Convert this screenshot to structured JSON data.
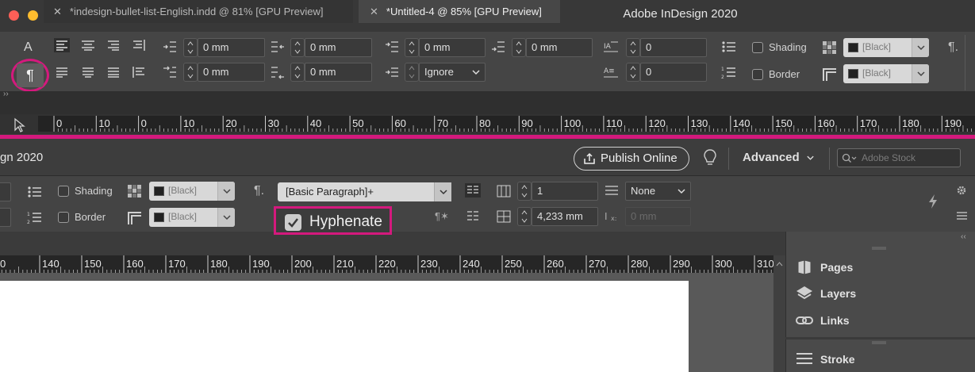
{
  "app": {
    "title": "Adobe InDesign 2020",
    "title_partial": "gn 2020"
  },
  "control_top": {
    "indent_left": "0 mm",
    "indent_first": "0 mm",
    "indent_right": "0 mm",
    "indent_last": "0 mm",
    "space_before": "0 mm",
    "space_after": "0 mm",
    "drop_cap_lines": "0",
    "drop_cap_chars": "0",
    "align_grid": "Ignore",
    "shading_label": "Shading",
    "border_label": "Border",
    "swatch_shading": "[Black]",
    "swatch_border": "[Black]"
  },
  "tabs": [
    {
      "label": "*indesign-bullet-list-English.indd @ 81% [GPU Preview]",
      "active": false
    },
    {
      "label": "*Untitled-4 @ 85% [GPU Preview]",
      "active": true
    }
  ],
  "ruler_top": [
    "0",
    "10",
    "0",
    "10",
    "20",
    "30",
    "40",
    "50",
    "60",
    "70",
    "80",
    "90",
    "100",
    "110",
    "120",
    "130",
    "140",
    "150",
    "160",
    "170",
    "180",
    "190"
  ],
  "header2": {
    "publish_label": "Publish Online",
    "workspace_label": "Advanced",
    "search_placeholder": "Adobe Stock"
  },
  "control_bottom": {
    "shading_label": "Shading",
    "border_label": "Border",
    "swatch_shading": "[Black]",
    "swatch_border": "[Black]",
    "paragraph_style": "[Basic Paragraph]+",
    "hyphenate_label": "Hyphenate",
    "columns": "1",
    "gutter": "4,233 mm",
    "span": "None",
    "span_gutter": "0 mm"
  },
  "ruler_bottom": [
    "0",
    "140",
    "150",
    "160",
    "170",
    "180",
    "190",
    "200",
    "210",
    "220",
    "230",
    "240",
    "250",
    "260",
    "270",
    "280",
    "290",
    "300",
    "310"
  ],
  "panels": [
    {
      "label": "Pages",
      "icon": "pages-icon"
    },
    {
      "label": "Layers",
      "icon": "layers-icon"
    },
    {
      "label": "Links",
      "icon": "links-icon"
    },
    {
      "label": "Stroke",
      "icon": "stroke-icon"
    }
  ],
  "colors": {
    "highlight": "#d4197d",
    "close": "#fe5f57",
    "minimize": "#febc2e",
    "zoom": "#28c840"
  }
}
